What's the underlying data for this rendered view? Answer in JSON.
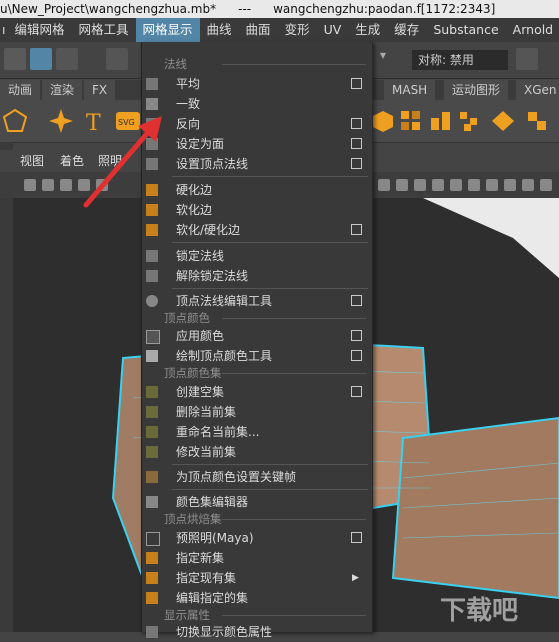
{
  "titlebar": {
    "project": "u\\New_Project\\wangchengzhua.mb*",
    "sep": "---",
    "file": "wangchengzhu:paodan.f[1172:2343]"
  },
  "menubar": [
    "编辑网格",
    "网格工具",
    "网格显示",
    "曲线",
    "曲面",
    "变形",
    "UV",
    "生成",
    "缓存",
    "Substance",
    "Arnold"
  ],
  "symmetry": "对称: 禁用",
  "shelf_tabs": [
    "动画",
    "渲染",
    "FX"
  ],
  "shelf_tabs_right": [
    "MASH",
    "运动图形",
    "XGen"
  ],
  "panel_menus": [
    "视图",
    "着色",
    "照明"
  ],
  "menu": {
    "sections": {
      "normals": "法线",
      "vertex_color": "顶点颜色",
      "vertex_color_set": "顶点颜色集",
      "vertex_bake_set": "顶点烘焙集",
      "display_attr": "显示属性"
    },
    "items": {
      "average": "平均",
      "conform": "一致",
      "reverse": "反向",
      "set_to_face": "设定为面",
      "set_vertex_normal": "设置顶点法线",
      "harden_edge": "硬化边",
      "soften_edge": "软化边",
      "soften_harden": "软化/硬化边",
      "lock_normals": "锁定法线",
      "unlock_normals": "解除锁定法线",
      "vertex_normal_edit": "顶点法线编辑工具",
      "apply_color": "应用颜色",
      "paint_vertex_color": "绘制顶点颜色工具",
      "create_empty_set": "创建空集",
      "delete_current_set": "删除当前集",
      "rename_current_set": "重命名当前集...",
      "modify_current_set": "修改当前集",
      "set_keyframe_vertex_color": "为顶点颜色设置关键帧",
      "color_set_editor": "颜色集编辑器",
      "prelight": "预照明(Maya)",
      "assign_new_set": "指定新集",
      "assign_existing_set": "指定现有集",
      "edit_assigned_set": "编辑指定的集",
      "toggle_display_color": "切换显示颜色属性"
    }
  },
  "watermark": "下载吧",
  "colors": {
    "accent": "#5285a6",
    "menu_bg": "#393939",
    "arrow": "#e03030",
    "mesh": "#3ad0f0"
  }
}
